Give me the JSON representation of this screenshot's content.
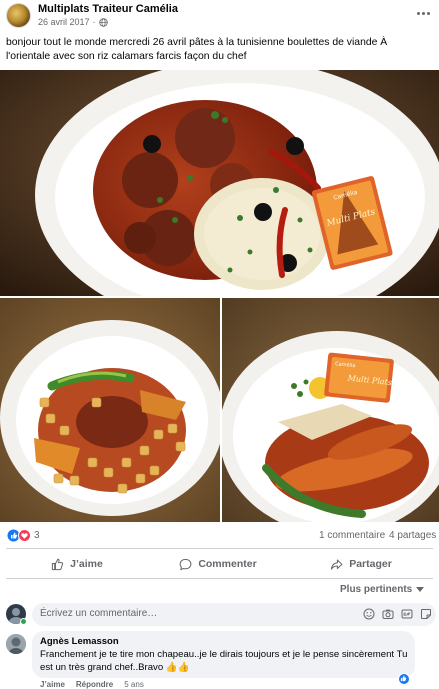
{
  "post": {
    "page_name": "Multiplats Traiteur Camélia",
    "date": "26 avril 2017",
    "date_sep": "·",
    "privacy_icon": "globe-icon",
    "text": "bonjour tout le monde mercredi 26 avril pâtes à la tunisienne boulettes de viande À l'orientale avec son riz calamars farcis façon du chef",
    "menu_icon": "more-options-icon"
  },
  "photos": {
    "main_card_text": "Multi Plats",
    "right_card_text": "Multi Plats",
    "main_logo_text": "Camélia",
    "right_logo_text": "Camélia"
  },
  "reactions": {
    "icons": [
      "like-icon",
      "love-icon"
    ],
    "count": "3",
    "comments": "1 commentaire",
    "shares": "4 partages"
  },
  "actions": {
    "like": "J’aime",
    "comment": "Commenter",
    "share": "Partager"
  },
  "comments_section": {
    "sort_label": "Plus pertinents",
    "input_placeholder": "Écrivez un commentaire…",
    "tools": [
      "emoji-icon",
      "camera-icon",
      "gif-icon",
      "sticker-icon"
    ],
    "items": [
      {
        "author": "Agnès Lemasson",
        "text": "Franchement je te tire mon chapeau..je le dirais toujours et je le pense sincèrement Tu est un très grand chef..Bravo 👍👍",
        "like_label": "J’aime",
        "reply_label": "Répondre",
        "time": "5 ans"
      }
    ]
  },
  "colors": {
    "brand_blue": "#1877f2",
    "love_red": "#f33e58",
    "secondary_text": "#65676b",
    "bubble_bg": "#f0f2f5"
  }
}
